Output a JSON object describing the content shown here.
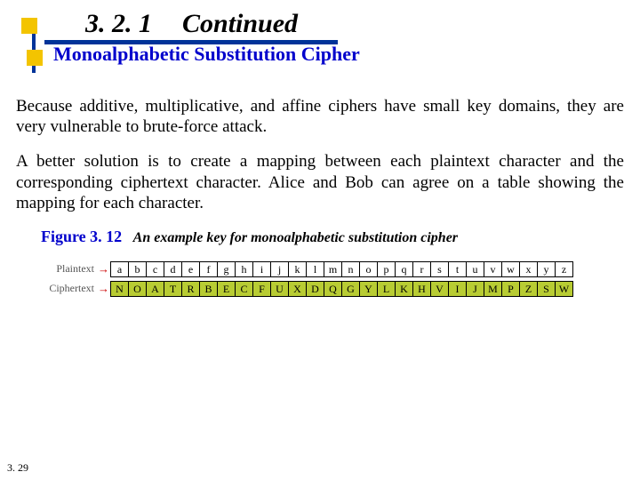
{
  "header": {
    "section_number": "3. 2. 1",
    "title_word": "Continued",
    "subtitle": "Monoalphabetic Substitution Cipher"
  },
  "body": {
    "p1": "Because additive, multiplicative, and affine ciphers have small key domains, they are very vulnerable to brute-force attack.",
    "p2": "A better solution is to create a mapping between each plaintext character and the corresponding ciphertext character. Alice and Bob can agree on a table showing the mapping for each character."
  },
  "figure": {
    "label": "Figure 3. 12",
    "caption": "An example key for monoalphabetic substitution cipher"
  },
  "cipher": {
    "row1_label": "Plaintext",
    "row2_label": "Ciphertext",
    "plaintext": [
      "a",
      "b",
      "c",
      "d",
      "e",
      "f",
      "g",
      "h",
      "i",
      "j",
      "k",
      "l",
      "m",
      "n",
      "o",
      "p",
      "q",
      "r",
      "s",
      "t",
      "u",
      "v",
      "w",
      "x",
      "y",
      "z"
    ],
    "ciphertext": [
      "N",
      "O",
      "A",
      "T",
      "R",
      "B",
      "E",
      "C",
      "F",
      "U",
      "X",
      "D",
      "Q",
      "G",
      "Y",
      "L",
      "K",
      "H",
      "V",
      "I",
      "J",
      "M",
      "P",
      "Z",
      "S",
      "W"
    ]
  },
  "page_number": "3. 29"
}
